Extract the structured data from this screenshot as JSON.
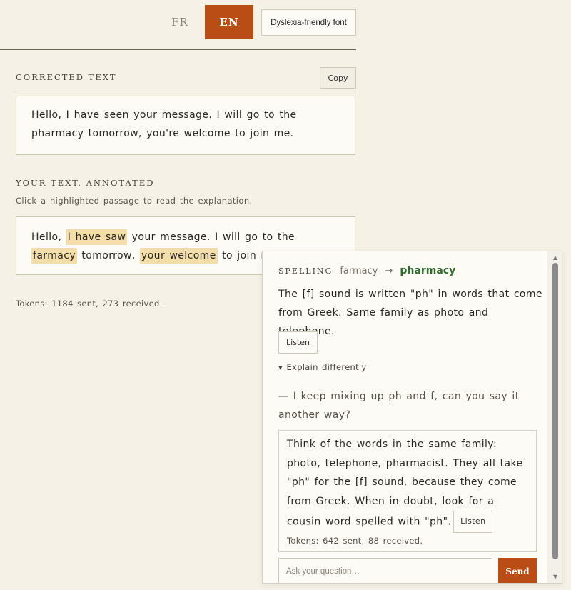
{
  "header": {
    "lang_fr": "FR",
    "lang_en": "EN",
    "dyslexia_button": "Dyslexia-friendly font",
    "accent_color": "#b84d16"
  },
  "corrected": {
    "title": "Corrected text",
    "copy_label": "Copy",
    "text": "Hello, I have seen your message. I will go to the pharmacy tomorrow, you're welcome to join me."
  },
  "annotated": {
    "title": "Your text, annotated",
    "hint": "Click a highlighted passage to read the explanation.",
    "segments": [
      {
        "text": "Hello, ",
        "highlight": false
      },
      {
        "text": "I have saw",
        "highlight": true
      },
      {
        "text": " your message. I will go to the ",
        "highlight": false
      },
      {
        "text": "farmacy",
        "highlight": true
      },
      {
        "text": " tomorrow, ",
        "highlight": false
      },
      {
        "text": "your welcome",
        "highlight": true
      },
      {
        "text": " to join me.",
        "highlight": false
      }
    ]
  },
  "tokens": "Tokens: 1184 sent, 273 received.",
  "popup": {
    "category": "Spelling",
    "wrong": "farmacy",
    "arrow": "→",
    "right": "pharmacy",
    "explanation": "The [f] sound is written \"ph\" in words that come from Greek. Same family as photo and telephone.",
    "listen_label": "Listen",
    "explain_toggle": "▾ Explain differently",
    "question": "— I keep mixing up ph and f, can you say it another way?",
    "answer": "Think of the words in the same family: photo, telephone, pharmacist. They all take \"ph\" for the [f] sound, because they come from Greek. When in doubt, look for a cousin word spelled with \"ph\".",
    "answer_listen_label": "Listen",
    "answer_tokens": "Tokens: 642 sent, 88 received.",
    "ask_placeholder": "Ask your question…",
    "send_label": "Send"
  }
}
